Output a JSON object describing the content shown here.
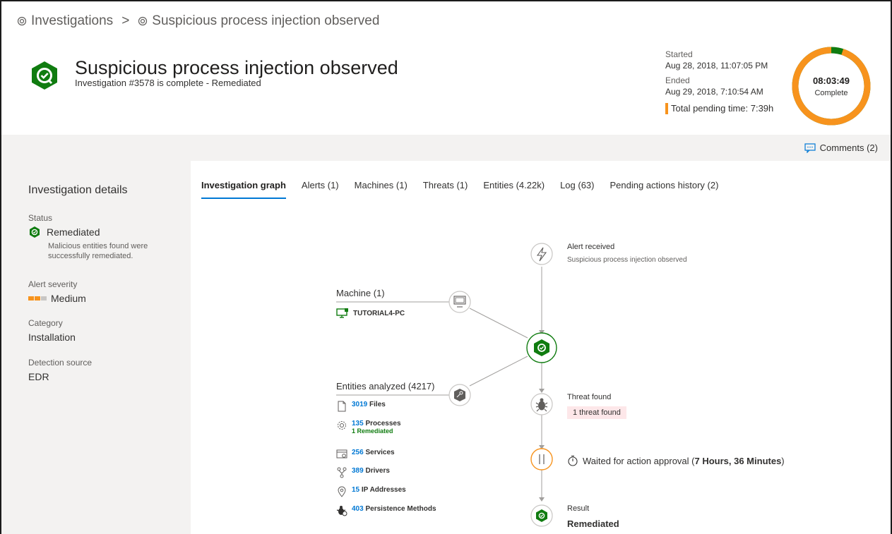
{
  "breadcrumb": {
    "root": "Investigations",
    "separator": ">",
    "current": "Suspicious process injection observed"
  },
  "header": {
    "title": "Suspicious process injection observed",
    "subtitle": "Investigation #3578 is complete - Remediated",
    "started_label": "Started",
    "started_value": "Aug 28, 2018, 11:07:05 PM",
    "ended_label": "Ended",
    "ended_value": "Aug 29, 2018, 7:10:54 AM",
    "pending_time": "Total pending time: 7:39h",
    "duration": "08:03:49",
    "duration_status": "Complete",
    "pending_fraction": 0.95
  },
  "toolbar": {
    "comments": "Comments (2)"
  },
  "details": {
    "heading": "Investigation details",
    "status_label": "Status",
    "status_value": "Remediated",
    "status_note_1": "Malicious entities found were",
    "status_note_2": "successfully remediated.",
    "severity_label": "Alert severity",
    "severity_value": "Medium",
    "severity_level": 2,
    "category_label": "Category",
    "category_value": "Installation",
    "source_label": "Detection source",
    "source_value": "EDR"
  },
  "tabs": [
    {
      "label": "Investigation graph"
    },
    {
      "label": "Alerts  (1)"
    },
    {
      "label": "Machines  (1)"
    },
    {
      "label": "Threats  (1)"
    },
    {
      "label": "Entities  (4.22k)"
    },
    {
      "label": "Log  (63)"
    },
    {
      "label": "Pending actions history  (2)"
    }
  ],
  "graph": {
    "alert_title": "Alert received",
    "alert_desc": "Suspicious process injection observed",
    "machine_title": "Machine (1)",
    "machine_name": "TUTORIAL4-PC",
    "entities_title": "Entities analyzed (4217)",
    "entities": [
      {
        "count": "3019",
        "label": "Files",
        "sub": "",
        "icon": "file-icon"
      },
      {
        "count": "135",
        "label": "Processes",
        "sub": "1 Remediated",
        "icon": "gear-icon"
      },
      {
        "count": "256",
        "label": "Services",
        "sub": "",
        "icon": "services-icon"
      },
      {
        "count": "389",
        "label": "Drivers",
        "sub": "",
        "icon": "drivers-icon"
      },
      {
        "count": "15",
        "label": "IP Addresses",
        "sub": "",
        "icon": "location-pin-icon"
      },
      {
        "count": "403",
        "label": "Persistence Methods",
        "sub": "",
        "icon": "persistence-icon"
      }
    ],
    "threat_title": "Threat found",
    "threat_badge": "1 threat found",
    "wait_prefix": "Waited for action approval (",
    "wait_bold": "7 Hours, 36 Minutes",
    "wait_suffix": ")",
    "result_title": "Result",
    "result_value": "Remediated"
  },
  "colors": {
    "accent": "#0078d4",
    "success": "#107c10",
    "warning": "#f7931d",
    "danger_bg": "#fde7e9"
  }
}
